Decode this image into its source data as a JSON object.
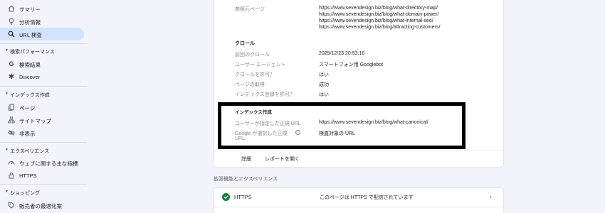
{
  "sidebar": {
    "items": [
      {
        "label": "サマリー",
        "icon": "home-icon"
      },
      {
        "label": "分析情報",
        "icon": "lightbulb-icon"
      },
      {
        "label": "URL 検査",
        "icon": "search-icon"
      }
    ],
    "sections": [
      {
        "title": "検索パフォーマンス",
        "items": [
          {
            "label": "検索結果",
            "icon": "google-g-icon"
          },
          {
            "label": "Discover",
            "icon": "asterisk-icon"
          }
        ]
      },
      {
        "title": "インデックス作成",
        "items": [
          {
            "label": "ページ",
            "icon": "pages-icon"
          },
          {
            "label": "サイトマップ",
            "icon": "sitemap-icon"
          },
          {
            "label": "非表示",
            "icon": "eye-off-icon"
          }
        ]
      },
      {
        "title": "エクスペリエンス",
        "items": [
          {
            "label": "ウェブに関する主な指標",
            "icon": "gauge-icon"
          },
          {
            "label": "HTTPS",
            "icon": "lock-icon"
          }
        ]
      },
      {
        "title": "ショッピング",
        "items": [
          {
            "label": "販売者の最適化案",
            "icon": "tag-icon"
          }
        ]
      }
    ]
  },
  "referrers": {
    "label": "参照元ページ",
    "urls": [
      "https://www.sevendesign.biz/blog/what-directory-map/",
      "https://www.sevendesign.biz/blog/what-domain-power/",
      "https://www.sevendesign.biz/blog/what-internal-seo/",
      "https://www.sevendesign.biz/blog/attracting-customers/"
    ]
  },
  "crawl": {
    "title": "クロール",
    "rows": [
      {
        "label": "前回のクロール",
        "value": "2025/12/23 20:53:16"
      },
      {
        "label": "ユーザー エージェント",
        "value": "スマートフォン用 Googlebot"
      },
      {
        "label": "クロールを許可？",
        "value": "はい"
      },
      {
        "label": "ページの取得",
        "value": "成功"
      },
      {
        "label": "インデックス登録を許可？",
        "value": "はい"
      }
    ]
  },
  "indexing": {
    "title": "インデックス作成",
    "user_canonical_label": "ユーザーが指定した正規 URL",
    "user_canonical_value": "https://www.sevendesign.biz/blog/what-canonical/",
    "google_canonical_label_1": "Google が選択した正規",
    "google_canonical_label_2": "URL",
    "google_canonical_value": "検査対象の URL",
    "help_glyph": "?"
  },
  "card_actions": {
    "details": "詳細",
    "open_report": "レポートを開く"
  },
  "enhancements": {
    "title": "拡張機能とエクスペリエンス",
    "https_name": "HTTPS",
    "https_status": "このページは HTTPS で配信されています"
  },
  "colors": {
    "accent": "#d3e3fd",
    "success": "#188038",
    "highlight_border": "#000000"
  }
}
